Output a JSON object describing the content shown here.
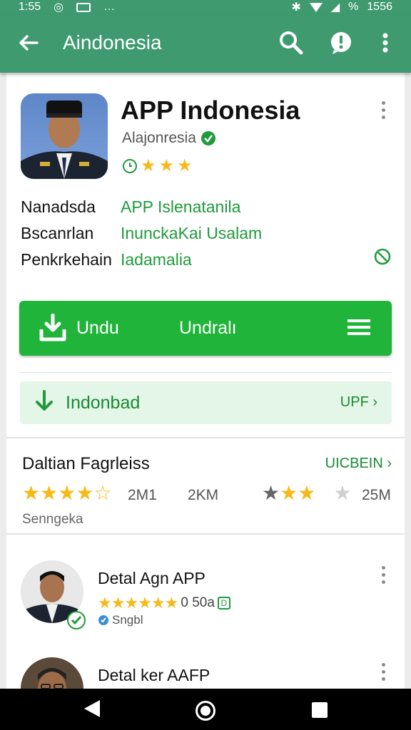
{
  "status_bar": {
    "time": "1:55",
    "battery": "1556",
    "percent": "%"
  },
  "app_bar": {
    "title": "Aindonesia"
  },
  "app": {
    "name": "APP Indonesia",
    "developer": "Alajonresia",
    "details": [
      {
        "label": "Nanadsda",
        "value": "APP Islenatanila"
      },
      {
        "label": "Bscanrlan",
        "value": "InunckaKai Usalam"
      },
      {
        "label": "Penkrkehain",
        "value": "Iadamalia"
      }
    ]
  },
  "install_button": {
    "left_label": "Undu",
    "center_label": "Undralı"
  },
  "download_banner": {
    "label": "Indonbad",
    "action": "UPF"
  },
  "ratings_section": {
    "title": "Daltian Fagrleiss",
    "link": "UICBEIN",
    "left_count": "2M1",
    "middle_count": "2KM",
    "right_count": "25M",
    "subtitle": "Senngeka",
    "left_stars_value": 4.5,
    "right_stars_value": 2
  },
  "list_items": [
    {
      "title": "Detal Agn APP",
      "rating_text": "0 50a",
      "tag": "Sngbl"
    },
    {
      "title": "Detal ker AAFP"
    }
  ],
  "colors": {
    "app_bar": "#3f9a70",
    "primary_green": "#20b43a",
    "text_green": "#178a34",
    "star_gold": "#f7b918",
    "star_gray": "#cfcfcf"
  },
  "icons": {
    "back": "arrow-left-icon",
    "search": "search-icon",
    "alert": "alert-circle-icon",
    "menu": "more-vertical-icon",
    "verified": "verified-check-icon",
    "download": "download-icon",
    "list": "menu-lines-icon"
  }
}
